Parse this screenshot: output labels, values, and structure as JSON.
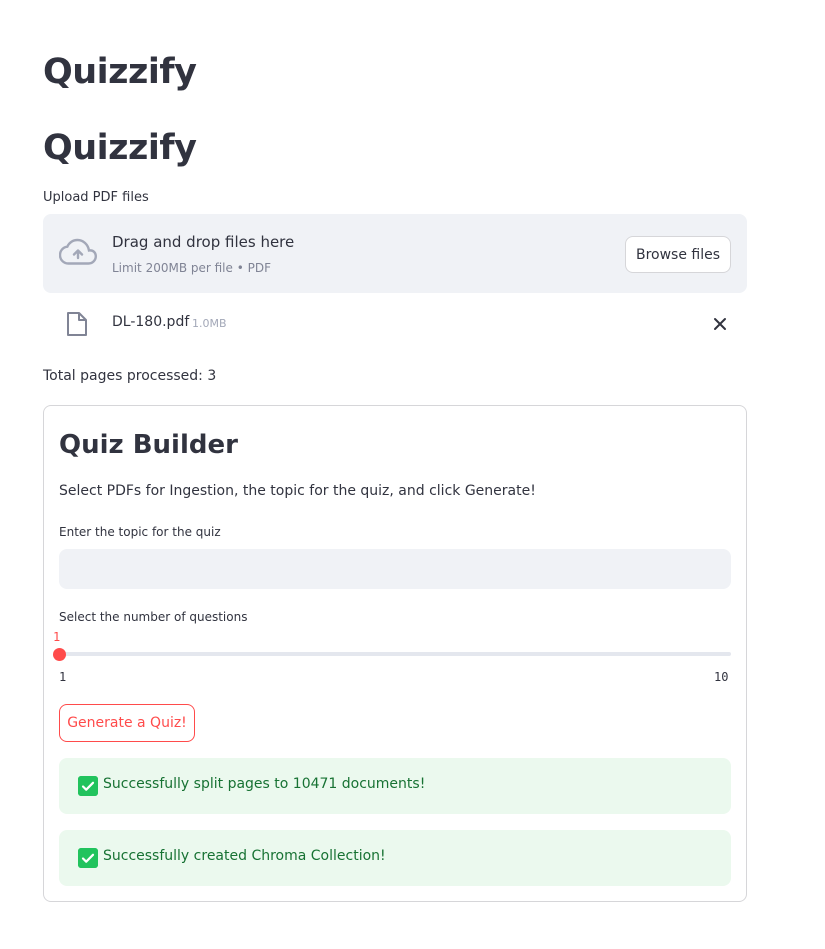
{
  "header": {
    "title": "Quizzify",
    "subtitle": "Quizzify"
  },
  "uploader": {
    "label": "Upload PDF files",
    "drop_title": "Drag and drop files here",
    "drop_hint": "Limit 200MB per file • PDF",
    "browse_label": "Browse files",
    "file": {
      "name": "DL-180.pdf",
      "size": "1.0MB"
    }
  },
  "status": {
    "pages_processed": "Total pages processed: 3"
  },
  "quiz_builder": {
    "title": "Quiz Builder",
    "description": "Select PDFs for Ingestion, the topic for the quiz, and click Generate!",
    "topic_label": "Enter the topic for the quiz",
    "topic_value": "",
    "topic_placeholder": "",
    "questions_label": "Select the number of questions",
    "slider": {
      "value": "1",
      "min": "1",
      "max": "10"
    },
    "generate_label": "Generate a Quiz!",
    "alerts": [
      "Successfully split pages to 10471 documents!",
      "Successfully created Chroma Collection!"
    ]
  },
  "colors": {
    "accent": "#ff4b4b",
    "success_bg": "#ebf9ee",
    "success_text": "#177233",
    "success_icon": "#21c35d",
    "input_bg": "#f0f2f6"
  },
  "icons": {
    "upload": "cloud-upload-icon",
    "file": "file-icon",
    "remove": "close-icon",
    "success": "check-icon"
  }
}
